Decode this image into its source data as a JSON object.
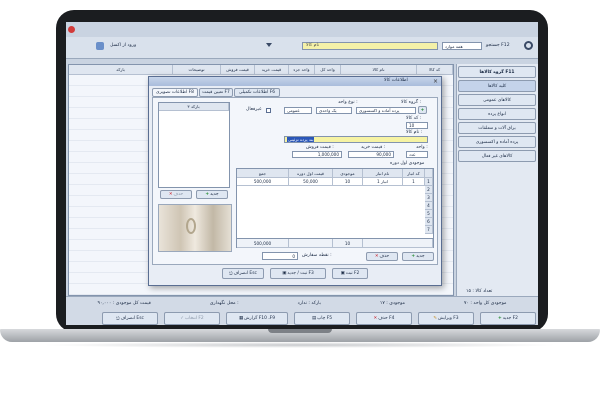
{
  "toolbar": {
    "search_label": "جستجو F12",
    "search_combo": "همه موارد",
    "filter_label": "نام کالا",
    "right_label": "ورود از اکسل",
    "right_combo": "..."
  },
  "sidebar": {
    "header": "گروه کالاها F11",
    "items": [
      {
        "label": "کلیه کالاها"
      },
      {
        "label": "کالاهای عمومی"
      },
      {
        "label": "انواع پرده"
      },
      {
        "label": "یراق آلات و متعلقات"
      },
      {
        "label": "پرده آماده و اکسسوری"
      },
      {
        "label": "کالاهای غیر فعال"
      }
    ]
  },
  "main_grid": {
    "columns": [
      "کد کالا",
      "نام کالا",
      "واحد کل",
      "واحد جزء",
      "قیمت خرید",
      "قیمت فروش",
      "توضیحات",
      "بارکد"
    ]
  },
  "status_bar": {
    "count_label": "تعداد کالا : ۱۵",
    "items": [
      {
        "label": "موجودی کل واحد : ۷۰"
      },
      {
        "label": "موجودی : ۱۷"
      },
      {
        "label": "بارکد : ندارد"
      },
      {
        "label": "محل نگهداری :"
      },
      {
        "label": "قیمت کل موجودی : ۹۰,۰۰۰"
      }
    ]
  },
  "bottom_buttons": [
    {
      "label": "جدید F2",
      "icon": "plus-icon"
    },
    {
      "label": "ویرایش F3",
      "icon": "edit-icon"
    },
    {
      "label": "حذف F4",
      "icon": "delete-icon"
    },
    {
      "label": "چاپ F5",
      "icon": "print-icon"
    },
    {
      "label": "گزارش F10 ،F9",
      "icon": "report-icon"
    },
    {
      "label": "انتخاب F2",
      "icon": "check-icon"
    },
    {
      "label": "انصراف Esc",
      "icon": "cancel-icon"
    }
  ],
  "dialog": {
    "title": "اطلاعات کالا",
    "tabs": [
      {
        "label": "اطلاعات تکمیلی F6"
      },
      {
        "label": "تعیین قیمت F7"
      },
      {
        "label": "اطلاعات تصویری F8"
      }
    ],
    "form": {
      "group_label": "گروه کالا :",
      "group_value": "پرده آماده و اکسسوری",
      "type_label": "نوع واحد :",
      "type_value": "یک واحدی",
      "unit_value": "عمومی",
      "inactive_label": "غیرفعال",
      "code_label": "کد کالا :",
      "code_value": "10",
      "name_label": "نام کالا :",
      "name_value": "بند پرده تزئینی",
      "unit_label": "واحد :",
      "unit_field": "عدد",
      "buy_label": "قیمت خرید :",
      "buy_value": "90,000",
      "sell_label": "قیمت فروش :",
      "sell_value": "1,000,000"
    },
    "barcode_table": {
      "header": "بارکد ۳",
      "add_label": "جدید",
      "delete_label": "حذف"
    },
    "inventory": {
      "title": "موجودی اول دوره",
      "columns": [
        "کد انبار",
        "نام انبار",
        "موجودی",
        "قیمت اول دوره",
        "جمع"
      ],
      "rows": [
        {
          "num": "1",
          "code": "1",
          "name": "انبار 1",
          "qty": "10",
          "price": "50,000",
          "total": "500,000"
        }
      ],
      "row_numbers": [
        "2",
        "3",
        "4",
        "5",
        "6",
        "7"
      ],
      "total_qty": "10",
      "total_sum": "500,000",
      "add_label": "جدید",
      "delete_label": "حذف",
      "reorder_label": "نقطه سفارش :",
      "reorder_value": "0"
    },
    "footer": {
      "save_label": "ثبت F2",
      "save_new_label": "ثبت / جدید F3",
      "cancel_label": "انصراف Esc"
    }
  }
}
